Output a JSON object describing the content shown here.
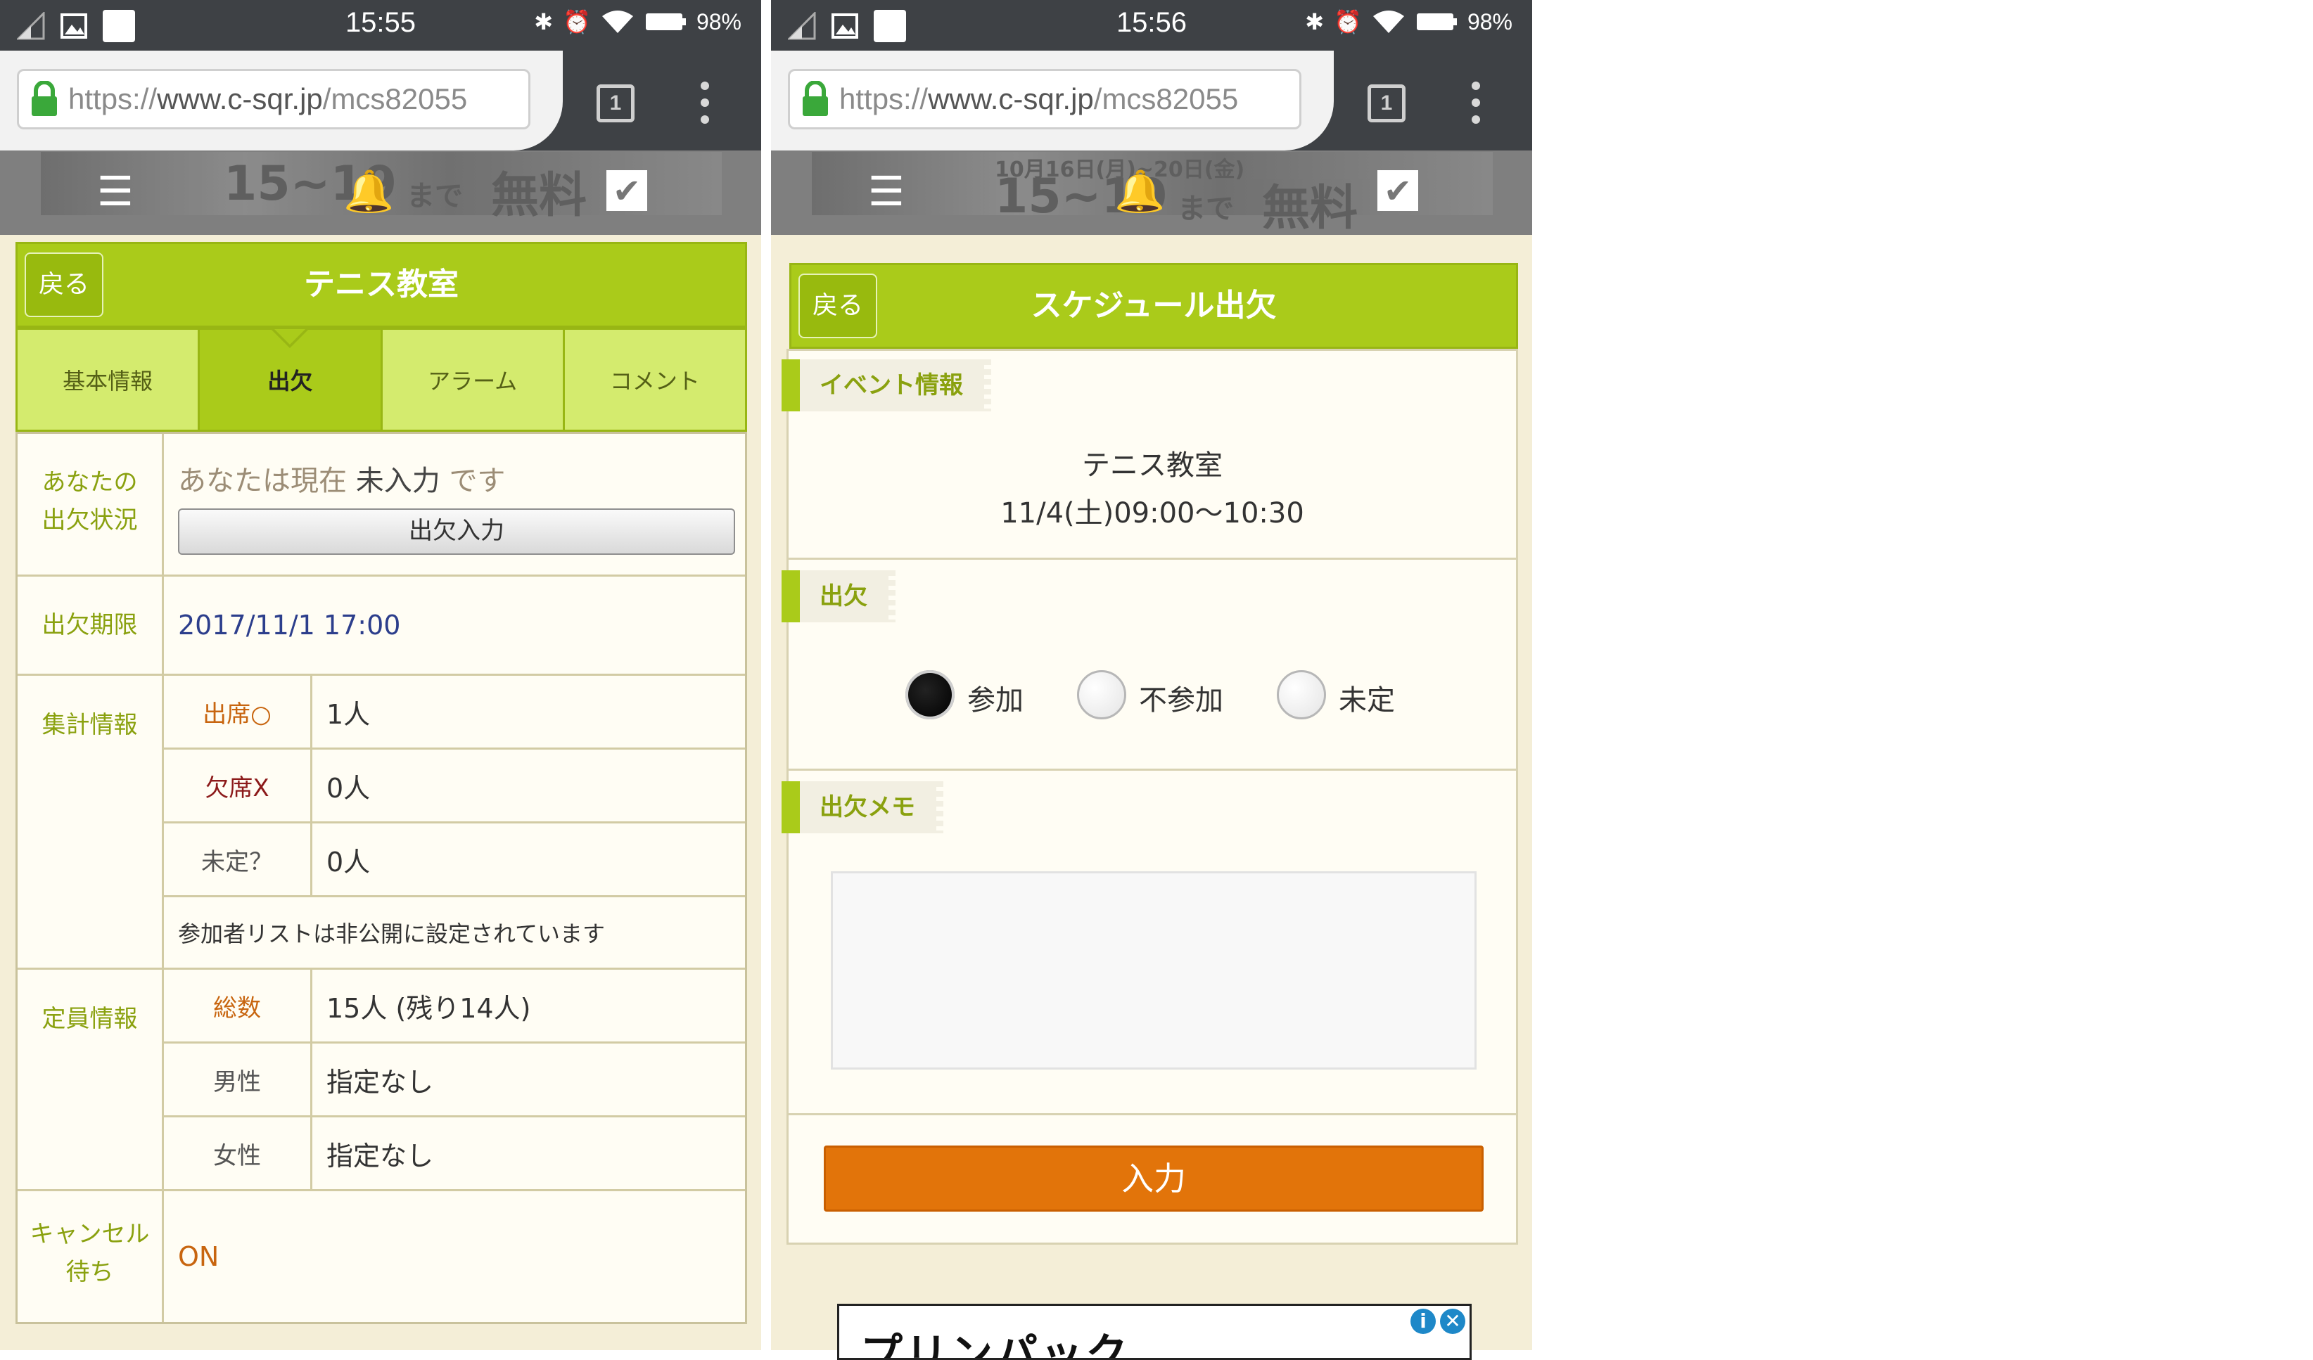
{
  "left": {
    "status": {
      "time": "15:55",
      "battery": "98%"
    },
    "url": {
      "scheme": "https://",
      "host": "www.c-sqr.jp",
      "path": "/mcs82055"
    },
    "tab_count": "1",
    "banner": {
      "text": "15~19",
      "text2": "まで",
      "text3": "無料"
    },
    "back_label": "戻る",
    "page_title": "テニス教室",
    "tabs": [
      "基本情報",
      "出欠",
      "アラーム",
      "コメント"
    ],
    "active_tab": 1,
    "status_label": "あなたの\n出欠状況",
    "status_prefix": "あなたは現在",
    "status_value": "未入力",
    "status_suffix": "です",
    "attend_button": "出欠入力",
    "deadline_label": "出欠期限",
    "deadline_value": "2017/11/1 17:00",
    "summary_label": "集計情報",
    "summary": [
      {
        "label": "出席○",
        "value": "1人",
        "color": "#c8650f"
      },
      {
        "label": "欠席X",
        "value": "0人",
        "color": "#8c1a1a"
      },
      {
        "label": "未定？",
        "value": "0人",
        "color": "#555555"
      }
    ],
    "private_note": "参加者リストは非公開に設定されています",
    "capacity_label": "定員情報",
    "capacity": [
      {
        "label": "総数",
        "value": "15人 (残り14人)",
        "color": "#c8650f"
      },
      {
        "label": "男性",
        "value": "指定なし",
        "color": "#555555"
      },
      {
        "label": "女性",
        "value": "指定なし",
        "color": "#555555"
      }
    ],
    "cancel_label": "キャンセル\n待ち",
    "cancel_value": "ON"
  },
  "right": {
    "status": {
      "time": "15:56",
      "battery": "98%"
    },
    "url": {
      "scheme": "https://",
      "host": "www.c-sqr.jp",
      "path": "/mcs82055"
    },
    "tab_count": "1",
    "banner": {
      "text": "15~19",
      "text2": "まで",
      "text3": "無料",
      "top": "10月16日(月)~20日(金)"
    },
    "back_label": "戻る",
    "page_title": "スケジュール出欠",
    "event_section": "イベント情報",
    "event_name": "テニス教室",
    "event_time": "11/4(土)09:00〜10:30",
    "attend_section": "出欠",
    "options": [
      "参加",
      "不参加",
      "未定"
    ],
    "selected_option": 0,
    "memo_section": "出欠メモ",
    "memo_value": "",
    "submit_label": "入力",
    "ad_text": "プリンパック"
  },
  "colors": {
    "accent": "#aacb1a",
    "submit": "#e2740a",
    "page_bg": "#f4eed7"
  }
}
